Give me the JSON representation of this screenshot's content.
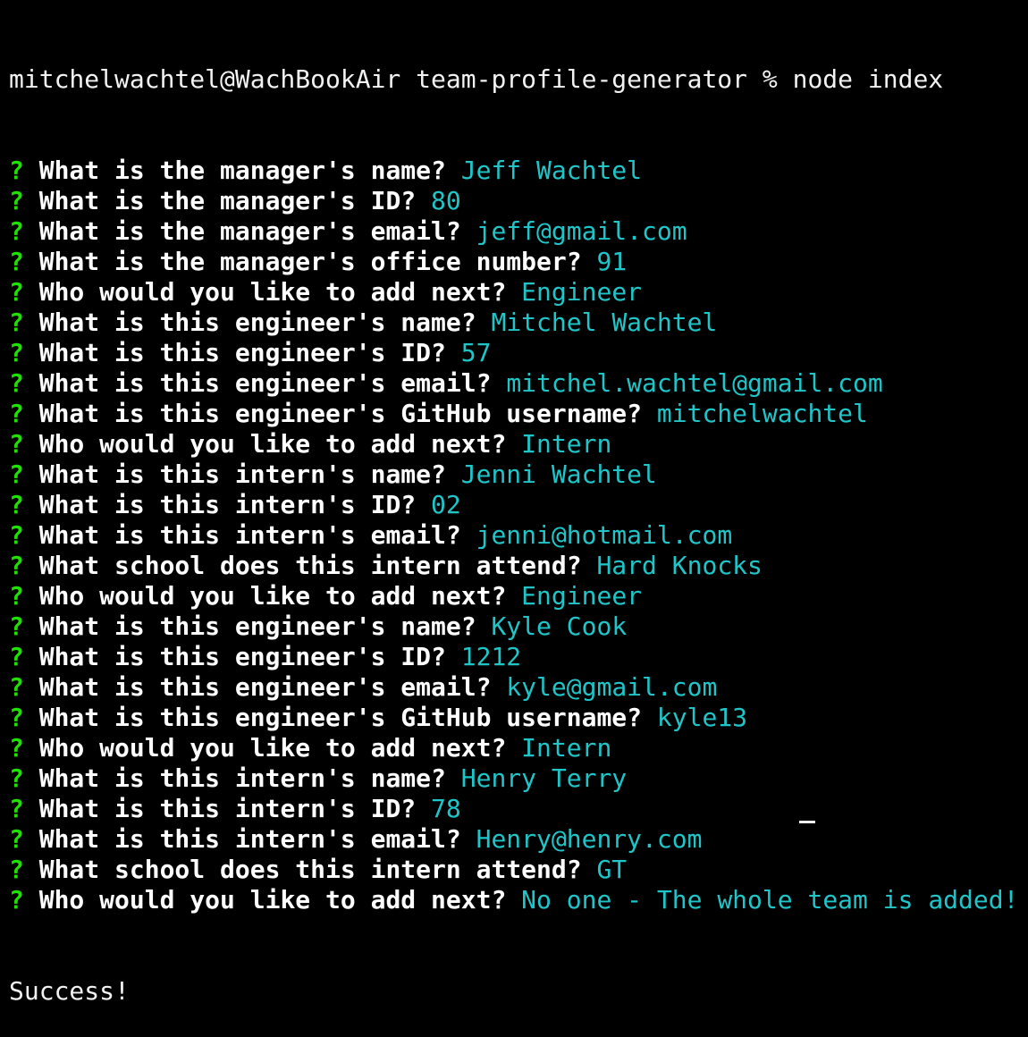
{
  "colors": {
    "background": "#000000",
    "text": "#f2f2f2",
    "prompt_marker": "#1fe000",
    "answer": "#1fc6c9"
  },
  "terminal": {
    "command_line": "mitchelwachtel@WachBookAir team-profile-generator % node index",
    "prompt_marker": "?",
    "qa": [
      {
        "question": "What is the manager's name?",
        "answer": "Jeff Wachtel"
      },
      {
        "question": "What is the manager's ID?",
        "answer": "80"
      },
      {
        "question": "What is the manager's email?",
        "answer": "jeff@gmail.com"
      },
      {
        "question": "What is the manager's office number?",
        "answer": "91"
      },
      {
        "question": "Who would you like to add next?",
        "answer": "Engineer"
      },
      {
        "question": "What is this engineer's name?",
        "answer": "Mitchel Wachtel"
      },
      {
        "question": "What is this engineer's ID?",
        "answer": "57"
      },
      {
        "question": "What is this engineer's email?",
        "answer": "mitchel.wachtel@gmail.com"
      },
      {
        "question": "What is this engineer's GitHub username?",
        "answer": "mitchelwachtel"
      },
      {
        "question": "Who would you like to add next?",
        "answer": "Intern"
      },
      {
        "question": "What is this intern's name?",
        "answer": "Jenni Wachtel"
      },
      {
        "question": "What is this intern's ID?",
        "answer": "02"
      },
      {
        "question": "What is this intern's email?",
        "answer": "jenni@hotmail.com"
      },
      {
        "question": "What school does this intern attend?",
        "answer": "Hard Knocks"
      },
      {
        "question": "Who would you like to add next?",
        "answer": "Engineer"
      },
      {
        "question": "What is this engineer's name?",
        "answer": "Kyle Cook"
      },
      {
        "question": "What is this engineer's ID?",
        "answer": "1212"
      },
      {
        "question": "What is this engineer's email?",
        "answer": "kyle@gmail.com"
      },
      {
        "question": "What is this engineer's GitHub username?",
        "answer": "kyle13"
      },
      {
        "question": "Who would you like to add next?",
        "answer": "Intern"
      },
      {
        "question": "What is this intern's name?",
        "answer": "Henry Terry"
      },
      {
        "question": "What is this intern's ID?",
        "answer": "78"
      },
      {
        "question": "What is this intern's email?",
        "answer": "Henry@henry.com"
      },
      {
        "question": "What school does this intern attend?",
        "answer": "GT"
      },
      {
        "question": "Who would you like to add next?",
        "answer": "No one - The whole team is added!"
      }
    ],
    "result_line": "Success!"
  }
}
